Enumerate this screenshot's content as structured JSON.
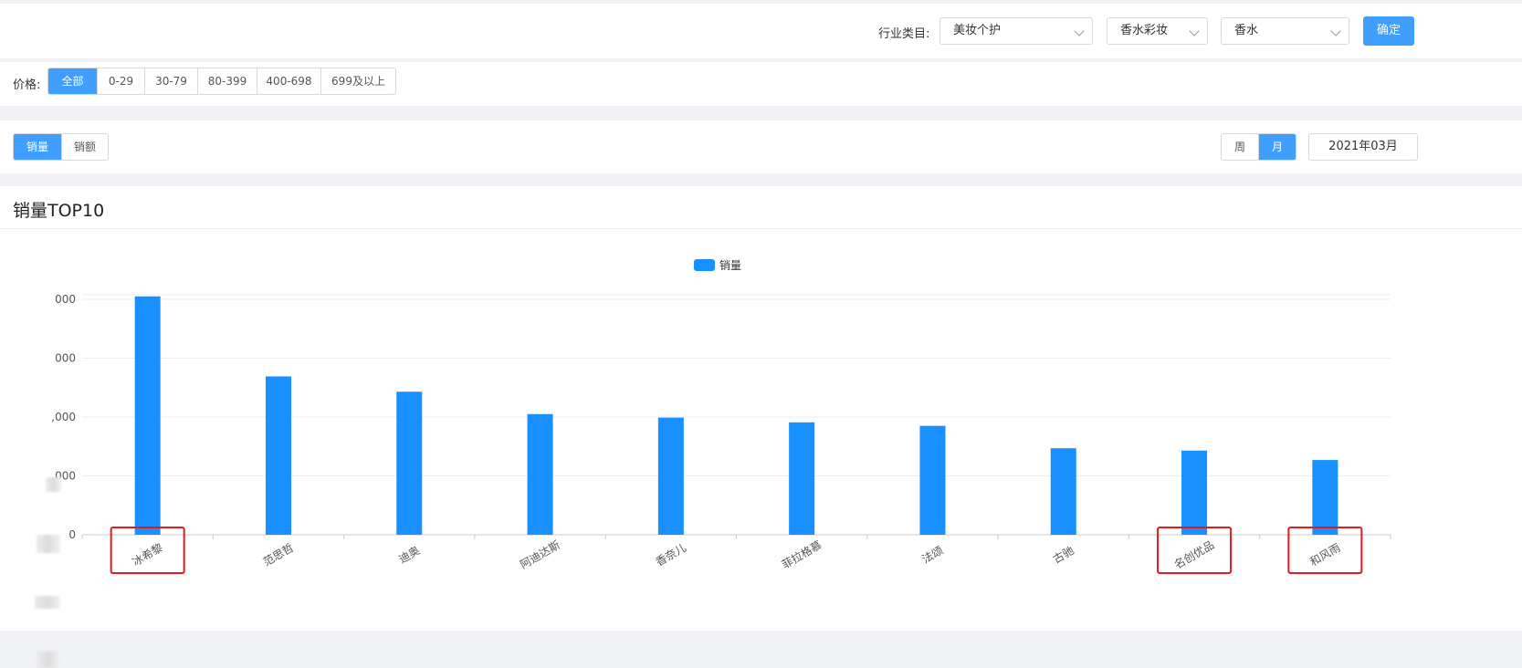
{
  "filters": {
    "industry_label": "行业类目:",
    "category1": "美妆个护",
    "category2": "香水彩妆",
    "category3": "香水",
    "confirm_label": "确定"
  },
  "price": {
    "label": "价格:",
    "options": [
      "全部",
      "0-29",
      "30-79",
      "80-399",
      "400-698",
      "699及以上"
    ],
    "selected": 0
  },
  "metric_tabs": {
    "options": [
      "销量",
      "销额"
    ],
    "selected": 0
  },
  "period_tabs": {
    "options": [
      "周",
      "月"
    ],
    "selected": 1
  },
  "date_value": "2021年03月",
  "chart_title": "销量TOP10",
  "chart_data": {
    "type": "bar",
    "title": "销量TOP10",
    "legend": {
      "entries": [
        "销量"
      ],
      "position": "top-center"
    },
    "categories": [
      "冰希黎",
      "范思哲",
      "迪奥",
      "阿迪达斯",
      "香奈儿",
      "菲拉格慕",
      "法颂",
      "古驰",
      "名创优品",
      "和风雨"
    ],
    "series": [
      {
        "name": "销量",
        "values": [
          4050,
          2690,
          2430,
          2050,
          1990,
          1910,
          1850,
          1470,
          1430,
          1270
        ]
      }
    ],
    "y_ticks": [
      "0",
      ",000",
      ",000",
      "000",
      "000"
    ],
    "ylim": [
      0,
      4000
    ],
    "grid": true,
    "colors": {
      "bar": "#1890ff",
      "axis": "#cccccc",
      "grid": "#eeeeee",
      "highlight": "#e6191c"
    },
    "highlighted_categories": [
      "冰希黎",
      "名创优品",
      "和风雨"
    ]
  }
}
